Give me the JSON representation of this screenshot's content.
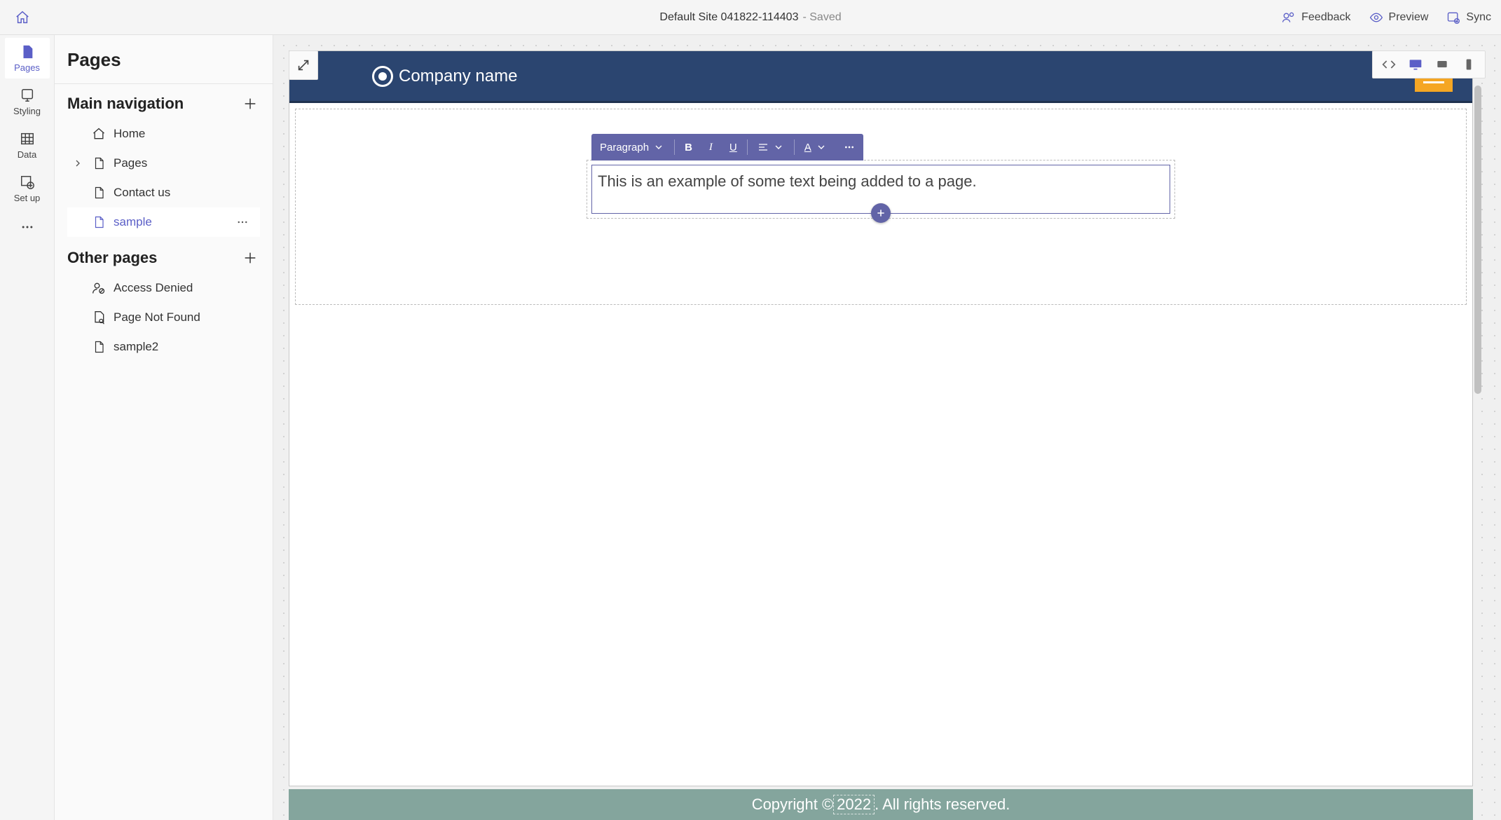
{
  "topbar": {
    "site_title": "Default Site 041822-114403",
    "saved_label": "- Saved",
    "feedback_label": "Feedback",
    "preview_label": "Preview",
    "sync_label": "Sync"
  },
  "rail": {
    "pages_label": "Pages",
    "styling_label": "Styling",
    "data_label": "Data",
    "setup_label": "Set up"
  },
  "panel": {
    "title": "Pages",
    "main_nav_label": "Main navigation",
    "other_pages_label": "Other pages",
    "main_nav_items": {
      "home": "Home",
      "pages": "Pages",
      "contact": "Contact us",
      "sample": "sample"
    },
    "other_items": {
      "access_denied": "Access Denied",
      "not_found": "Page Not Found",
      "sample2": "sample2"
    }
  },
  "editor_toolbar": {
    "style_dropdown": "Paragraph"
  },
  "preview_page": {
    "company_name": "Company name",
    "body_text": "This is an example of some text being added to a page.",
    "footer_prefix": "Copyright © ",
    "footer_year": "2022",
    "footer_suffix": ". All rights reserved."
  }
}
